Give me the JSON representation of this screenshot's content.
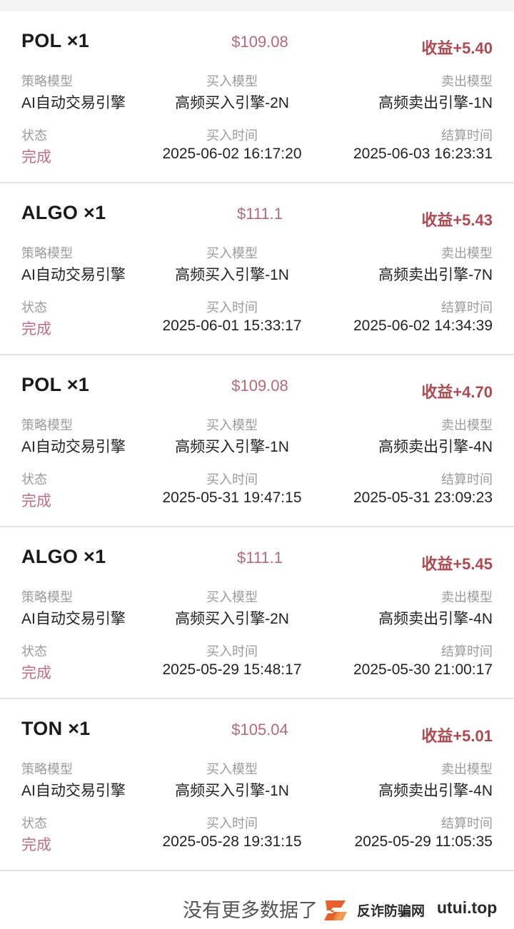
{
  "labels": {
    "strategy_model": "策略模型",
    "buy_model": "买入模型",
    "sell_model": "卖出模型",
    "status": "状态",
    "buy_time": "买入时间",
    "settle_time": "结算时间"
  },
  "colors": {
    "profit": "#b0484f",
    "price": "#b46a76",
    "status": "#c46d82"
  },
  "orders": [
    {
      "symbol": "POL ×1",
      "price": "$109.08",
      "profit": "收益+5.40",
      "strategy_model": "AI自动交易引擎",
      "buy_model": "高频买入引擎-2N",
      "sell_model": "高频卖出引擎-1N",
      "status": "完成",
      "buy_time": "2025-06-02 16:17:20",
      "settle_time": "2025-06-03 16:23:31"
    },
    {
      "symbol": "ALGO ×1",
      "price": "$111.1",
      "profit": "收益+5.43",
      "strategy_model": "AI自动交易引擎",
      "buy_model": "高频买入引擎-1N",
      "sell_model": "高频卖出引擎-7N",
      "status": "完成",
      "buy_time": "2025-06-01 15:33:17",
      "settle_time": "2025-06-02 14:34:39"
    },
    {
      "symbol": "POL ×1",
      "price": "$109.08",
      "profit": "收益+4.70",
      "strategy_model": "AI自动交易引擎",
      "buy_model": "高频买入引擎-1N",
      "sell_model": "高频卖出引擎-4N",
      "status": "完成",
      "buy_time": "2025-05-31 19:47:15",
      "settle_time": "2025-05-31 23:09:23"
    },
    {
      "symbol": "ALGO ×1",
      "price": "$111.1",
      "profit": "收益+5.45",
      "strategy_model": "AI自动交易引擎",
      "buy_model": "高频买入引擎-2N",
      "sell_model": "高频卖出引擎-4N",
      "status": "完成",
      "buy_time": "2025-05-29 15:48:17",
      "settle_time": "2025-05-30 21:00:17"
    },
    {
      "symbol": "TON ×1",
      "price": "$105.04",
      "profit": "收益+5.01",
      "strategy_model": "AI自动交易引擎",
      "buy_model": "高频买入引擎-1N",
      "sell_model": "高频卖出引擎-4N",
      "status": "完成",
      "buy_time": "2025-05-28 19:31:15",
      "settle_time": "2025-05-29 11:05:35"
    }
  ],
  "footer": {
    "no_more_data": "没有更多数据了"
  },
  "watermark": {
    "icon": "utui-logo-icon",
    "text": "反诈防骗网",
    "domain": "utui.top"
  }
}
